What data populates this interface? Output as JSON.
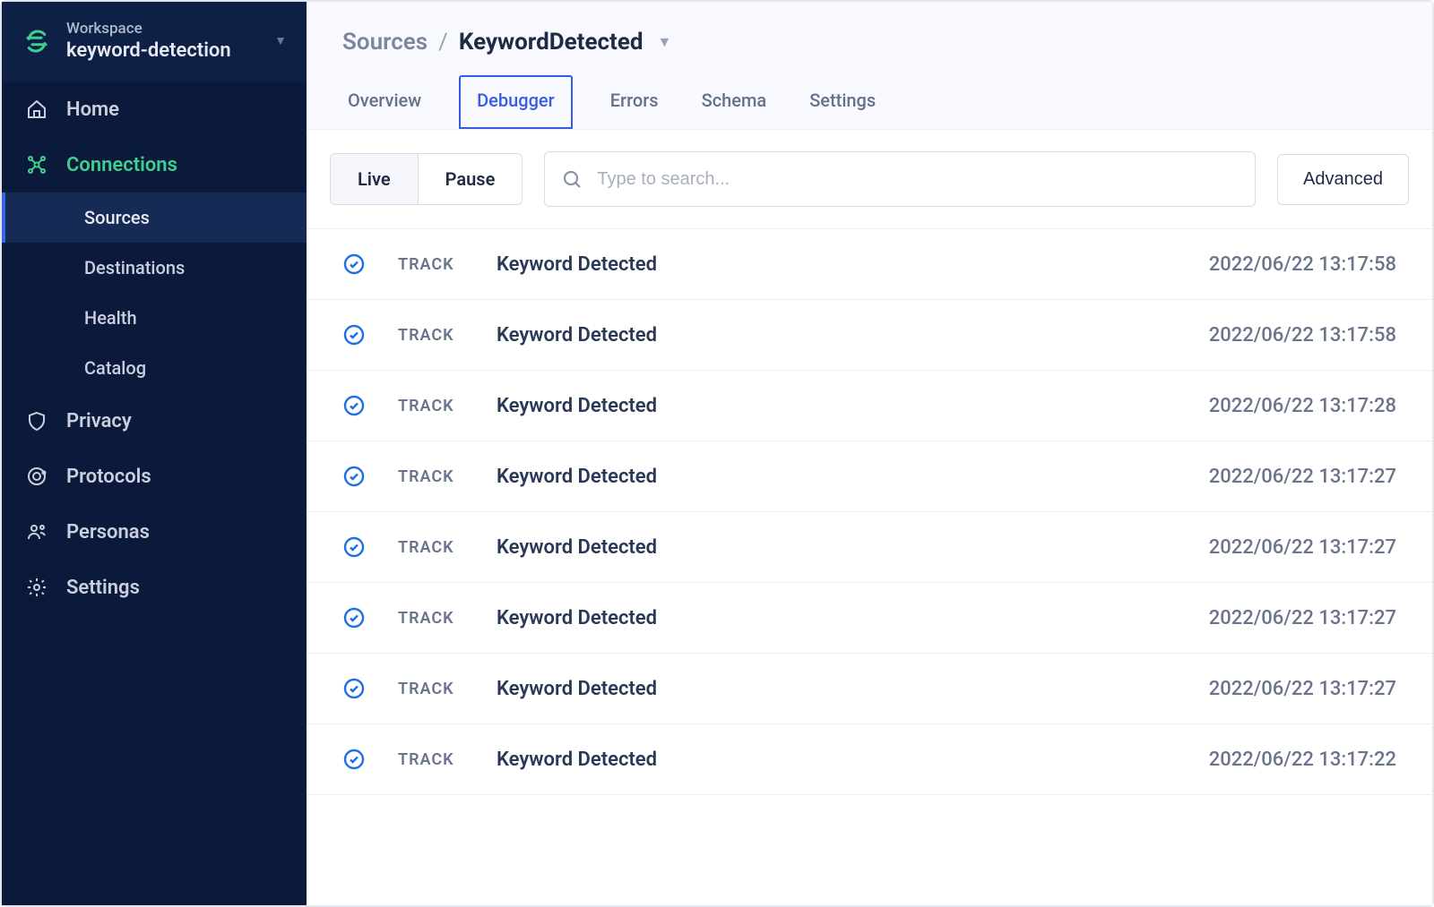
{
  "workspace": {
    "label": "Workspace",
    "name": "keyword-detection"
  },
  "sidebar": {
    "items": [
      {
        "id": "home",
        "label": "Home"
      },
      {
        "id": "connections",
        "label": "Connections"
      },
      {
        "id": "privacy",
        "label": "Privacy"
      },
      {
        "id": "protocols",
        "label": "Protocols"
      },
      {
        "id": "personas",
        "label": "Personas"
      },
      {
        "id": "settings",
        "label": "Settings"
      }
    ],
    "connections_sub": [
      {
        "id": "sources",
        "label": "Sources"
      },
      {
        "id": "destinations",
        "label": "Destinations"
      },
      {
        "id": "health",
        "label": "Health"
      },
      {
        "id": "catalog",
        "label": "Catalog"
      }
    ]
  },
  "breadcrumb": {
    "root": "Sources",
    "sep": "/",
    "current": "KeywordDetected"
  },
  "tabs": {
    "overview": "Overview",
    "debugger": "Debugger",
    "errors": "Errors",
    "schema": "Schema",
    "settings": "Settings"
  },
  "toolbar": {
    "live": "Live",
    "pause": "Pause",
    "search_placeholder": "Type to search...",
    "advanced": "Advanced"
  },
  "events": [
    {
      "type": "TRACK",
      "name": "Keyword Detected",
      "time": "2022/06/22 13:17:58"
    },
    {
      "type": "TRACK",
      "name": "Keyword Detected",
      "time": "2022/06/22 13:17:58"
    },
    {
      "type": "TRACK",
      "name": "Keyword Detected",
      "time": "2022/06/22 13:17:28"
    },
    {
      "type": "TRACK",
      "name": "Keyword Detected",
      "time": "2022/06/22 13:17:27"
    },
    {
      "type": "TRACK",
      "name": "Keyword Detected",
      "time": "2022/06/22 13:17:27"
    },
    {
      "type": "TRACK",
      "name": "Keyword Detected",
      "time": "2022/06/22 13:17:27"
    },
    {
      "type": "TRACK",
      "name": "Keyword Detected",
      "time": "2022/06/22 13:17:27"
    },
    {
      "type": "TRACK",
      "name": "Keyword Detected",
      "time": "2022/06/22 13:17:22"
    }
  ]
}
